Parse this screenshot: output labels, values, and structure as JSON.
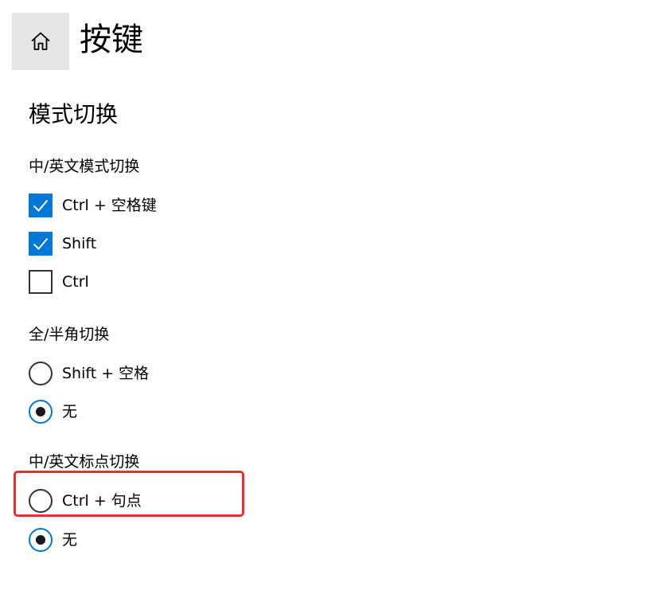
{
  "header": {
    "home_icon": "home-icon",
    "title": "按键"
  },
  "section": {
    "title": "模式切换"
  },
  "groups": {
    "lang_switch": {
      "label": "中/英文模式切换",
      "options": [
        {
          "label": "Ctrl + 空格键",
          "checked": true
        },
        {
          "label": "Shift",
          "checked": true
        },
        {
          "label": "Ctrl",
          "checked": false
        }
      ]
    },
    "width_switch": {
      "label": "全/半角切换",
      "options": [
        {
          "label": "Shift + 空格",
          "selected": false
        },
        {
          "label": "无",
          "selected": true
        }
      ]
    },
    "punct_switch": {
      "label": "中/英文标点切换",
      "options": [
        {
          "label": "Ctrl + 句点",
          "selected": false
        },
        {
          "label": "无",
          "selected": true
        }
      ]
    }
  },
  "colors": {
    "accent": "#0078d7",
    "highlight": "#ee2f2f"
  }
}
